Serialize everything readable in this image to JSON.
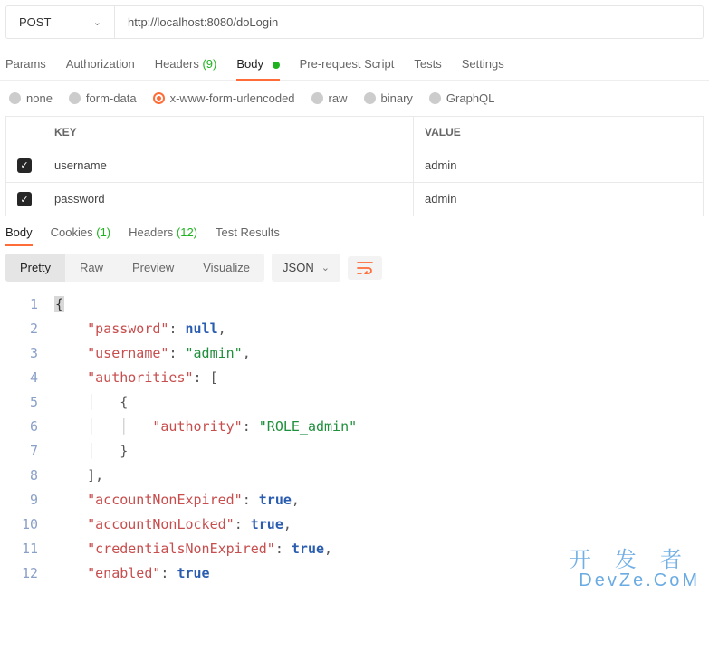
{
  "request": {
    "method": "POST",
    "url": "http://localhost:8080/doLogin"
  },
  "tabs": {
    "params": "Params",
    "auth": "Authorization",
    "headers_label": "Headers",
    "headers_count": "(9)",
    "body": "Body",
    "prerequest": "Pre-request Script",
    "tests": "Tests",
    "settings": "Settings"
  },
  "body_types": {
    "none": "none",
    "formdata": "form-data",
    "urlencoded": "x-www-form-urlencoded",
    "raw": "raw",
    "binary": "binary",
    "graphql": "GraphQL"
  },
  "kv": {
    "key_header": "KEY",
    "value_header": "VALUE",
    "rows": [
      {
        "key": "username",
        "value": "admin"
      },
      {
        "key": "password",
        "value": "admin"
      }
    ]
  },
  "response_tabs": {
    "body": "Body",
    "cookies_label": "Cookies",
    "cookies_count": "(1)",
    "headers_label": "Headers",
    "headers_count": "(12)",
    "tests": "Test Results"
  },
  "view": {
    "pretty": "Pretty",
    "raw": "Raw",
    "preview": "Preview",
    "visualize": "Visualize",
    "format": "JSON"
  },
  "json_lines": [
    {
      "n": "1",
      "indent": "",
      "tokens": [
        {
          "t": "bracehl",
          "v": "{"
        }
      ]
    },
    {
      "n": "2",
      "indent": "    ",
      "tokens": [
        {
          "t": "key",
          "v": "\"password\""
        },
        {
          "t": "punct",
          "v": ": "
        },
        {
          "t": "kw",
          "v": "null"
        },
        {
          "t": "punct",
          "v": ","
        }
      ]
    },
    {
      "n": "3",
      "indent": "    ",
      "tokens": [
        {
          "t": "key",
          "v": "\"username\""
        },
        {
          "t": "punct",
          "v": ": "
        },
        {
          "t": "str",
          "v": "\"admin\""
        },
        {
          "t": "punct",
          "v": ","
        }
      ]
    },
    {
      "n": "4",
      "indent": "    ",
      "tokens": [
        {
          "t": "key",
          "v": "\"authorities\""
        },
        {
          "t": "punct",
          "v": ": ["
        }
      ]
    },
    {
      "n": "5",
      "indent": "    ",
      "tokens": [
        {
          "t": "guide",
          "v": "│   "
        },
        {
          "t": "punct",
          "v": "{"
        }
      ]
    },
    {
      "n": "6",
      "indent": "    ",
      "tokens": [
        {
          "t": "guide",
          "v": "│   │   "
        },
        {
          "t": "key",
          "v": "\"authority\""
        },
        {
          "t": "punct",
          "v": ": "
        },
        {
          "t": "str",
          "v": "\"ROLE_admin\""
        }
      ]
    },
    {
      "n": "7",
      "indent": "    ",
      "tokens": [
        {
          "t": "guide",
          "v": "│   "
        },
        {
          "t": "punct",
          "v": "}"
        }
      ]
    },
    {
      "n": "8",
      "indent": "    ",
      "tokens": [
        {
          "t": "punct",
          "v": "],"
        }
      ]
    },
    {
      "n": "9",
      "indent": "    ",
      "tokens": [
        {
          "t": "key",
          "v": "\"accountNonExpired\""
        },
        {
          "t": "punct",
          "v": ": "
        },
        {
          "t": "kw",
          "v": "true"
        },
        {
          "t": "punct",
          "v": ","
        }
      ]
    },
    {
      "n": "10",
      "indent": "    ",
      "tokens": [
        {
          "t": "key",
          "v": "\"accountNonLocked\""
        },
        {
          "t": "punct",
          "v": ": "
        },
        {
          "t": "kw",
          "v": "true"
        },
        {
          "t": "punct",
          "v": ","
        }
      ]
    },
    {
      "n": "11",
      "indent": "    ",
      "tokens": [
        {
          "t": "key",
          "v": "\"credentialsNonExpired\""
        },
        {
          "t": "punct",
          "v": ": "
        },
        {
          "t": "kw",
          "v": "true"
        },
        {
          "t": "punct",
          "v": ","
        }
      ]
    },
    {
      "n": "12",
      "indent": "    ",
      "tokens": [
        {
          "t": "key",
          "v": "\"enabled\""
        },
        {
          "t": "punct",
          "v": ": "
        },
        {
          "t": "kw",
          "v": "true"
        }
      ]
    }
  ],
  "watermark": {
    "cn": "开 发 者",
    "en": "DevZe.CoM"
  }
}
